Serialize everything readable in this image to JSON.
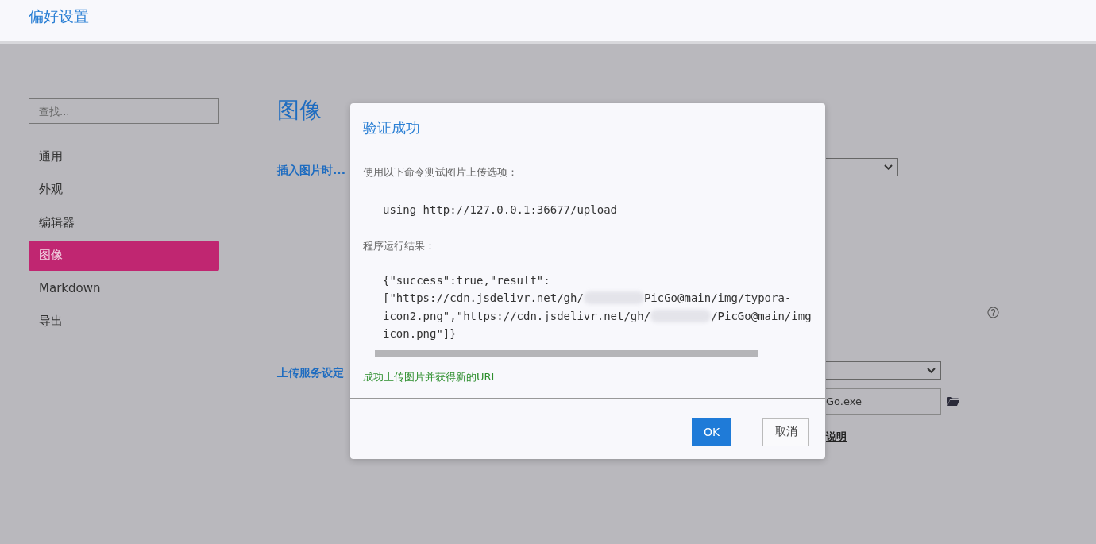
{
  "header": {
    "title": "偏好设置"
  },
  "sidebar": {
    "search": {
      "placeholder": "查找..."
    },
    "items": [
      {
        "label": "通用",
        "selected": false
      },
      {
        "label": "外观",
        "selected": false
      },
      {
        "label": "编辑器",
        "selected": false
      },
      {
        "label": "图像",
        "selected": true
      },
      {
        "label": "Markdown",
        "selected": false
      },
      {
        "label": "导出",
        "selected": false
      }
    ]
  },
  "page": {
    "heading": "图像",
    "sections": [
      {
        "label": "插入图片时..."
      },
      {
        "label": "上传服务设定"
      }
    ],
    "path_field": {
      "value": "Go.exe"
    },
    "link": "说明"
  },
  "dialog": {
    "title": "验证成功",
    "intro": "使用以下命令测试图片上传选项：",
    "command": "using http://127.0.0.1:36677/upload",
    "result_label": "程序运行结果：",
    "result_lines": [
      [
        "{\"success\":true,\"result\":"
      ],
      [
        "[\"https://cdn.jsdelivr.net/gh/",
        "PicGo@main/img/typora-"
      ],
      [
        "icon2.png\",\"https://cdn.jsdelivr.net/gh/",
        "/PicGo@main/img"
      ],
      [
        "icon.png\"]}"
      ]
    ],
    "status": "成功上传图片并获得新的URL",
    "buttons": [
      {
        "label": "OK",
        "kind": "primary"
      },
      {
        "label": "取消",
        "kind": "secondary"
      }
    ]
  }
}
